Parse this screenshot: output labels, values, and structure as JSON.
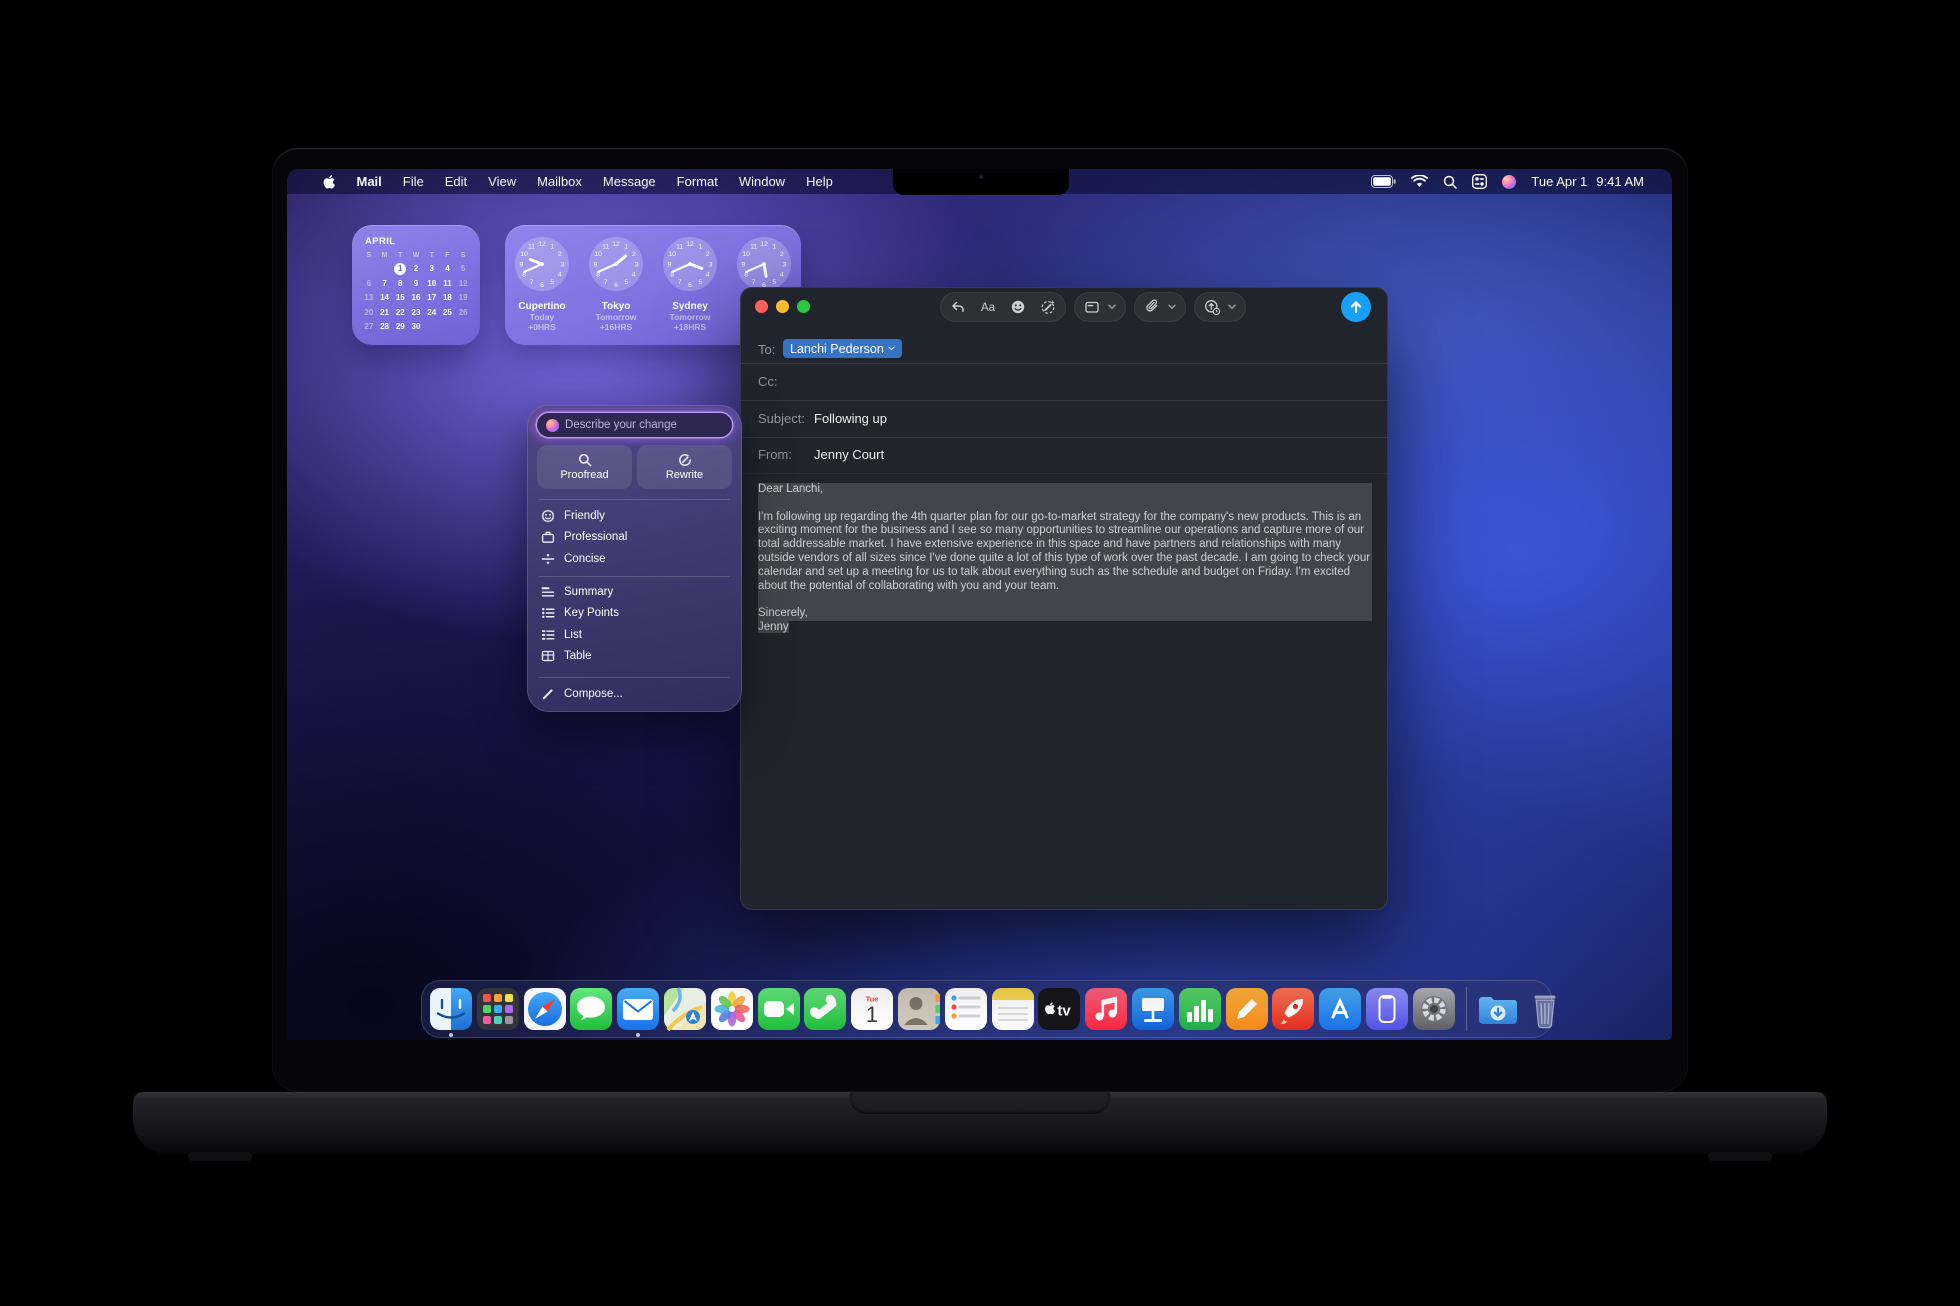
{
  "menu_bar": {
    "active_app": "Mail",
    "menus": [
      "Mail",
      "File",
      "Edit",
      "View",
      "Mailbox",
      "Message",
      "Format",
      "Window",
      "Help"
    ],
    "status_icons": [
      "battery",
      "wifi",
      "spotlight",
      "control-center",
      "siri"
    ],
    "date": "Tue Apr 1",
    "time": "9:41 AM"
  },
  "widgets": {
    "calendar": {
      "month": "APRIL",
      "day_headers": [
        "S",
        "M",
        "T",
        "W",
        "T",
        "F",
        "S"
      ],
      "weeks": [
        [
          "",
          "",
          "1",
          "2",
          "3",
          "4",
          "5"
        ],
        [
          "6",
          "7",
          "8",
          "9",
          "10",
          "11",
          "12"
        ],
        [
          "13",
          "14",
          "15",
          "16",
          "17",
          "18",
          "19"
        ],
        [
          "20",
          "21",
          "22",
          "23",
          "24",
          "25",
          "26"
        ],
        [
          "27",
          "28",
          "29",
          "30",
          "",
          "",
          ""
        ]
      ],
      "selected_day": "1"
    },
    "world_clocks": {
      "cities": [
        {
          "name": "Cupertino",
          "day_label": "Today",
          "offset_label": "+0HRS",
          "hour": 9,
          "minute": 41
        },
        {
          "name": "Tokyo",
          "day_label": "Tomorrow",
          "offset_label": "+16HRS",
          "hour": 1,
          "minute": 41
        },
        {
          "name": "Sydney",
          "day_label": "Tomorrow",
          "offset_label": "+18HRS",
          "hour": 3,
          "minute": 41
        },
        {
          "name": "",
          "day_label": "",
          "offset_label": "",
          "hour": 5,
          "minute": 41
        }
      ]
    }
  },
  "writing_tools": {
    "input_placeholder": "Describe your change",
    "primary_buttons": [
      {
        "label": "Proofread",
        "icon": "magnifier"
      },
      {
        "label": "Rewrite",
        "icon": "rewrite"
      }
    ],
    "tone_options": [
      {
        "label": "Friendly",
        "icon": "smiley"
      },
      {
        "label": "Professional",
        "icon": "briefcase"
      },
      {
        "label": "Concise",
        "icon": "concise"
      }
    ],
    "format_options": [
      {
        "label": "Summary",
        "icon": "summary"
      },
      {
        "label": "Key Points",
        "icon": "keypoints"
      },
      {
        "label": "List",
        "icon": "list"
      },
      {
        "label": "Table",
        "icon": "table"
      }
    ],
    "compose_option": {
      "label": "Compose...",
      "icon": "pencil"
    }
  },
  "mail_window": {
    "toolbar_groups": [
      {
        "icons": [
          "undo",
          "format",
          "emoji",
          "writing-tools"
        ],
        "chevron": false
      },
      {
        "icons": [
          "header-fields"
        ],
        "chevron": true
      },
      {
        "icons": [
          "attach"
        ],
        "chevron": true
      },
      {
        "icons": [
          "insert"
        ],
        "chevron": true
      }
    ],
    "fields": {
      "to_label": "To:",
      "to_value": "Lanchi Pederson",
      "cc_label": "Cc:",
      "cc_value": "",
      "subject_label": "Subject:",
      "subject_value": "Following up",
      "from_label": "From:",
      "from_value": "Jenny Court"
    },
    "body": {
      "greeting": "Dear Lanchi,",
      "paragraph": "I'm following up regarding the 4th quarter plan for our go-to-market strategy for the company's new products. This is an exciting moment for the business and I see so many opportunities to streamline our operations and capture more of our total addressable market. I have extensive experience in this space and have partners and relationships with many outside vendors of all sizes since I've done quite a lot of this type of work over the past decade. I am going to check your calendar and set up a meeting for us to talk about everything such as the schedule and budget on Friday. I'm excited about the potential of collaborating with you and your team.",
      "closing": "Sincerely,",
      "signature": "Jenny"
    }
  },
  "dock": {
    "items": [
      {
        "name": "finder",
        "running": true
      },
      {
        "name": "launchpad"
      },
      {
        "name": "safari"
      },
      {
        "name": "messages"
      },
      {
        "name": "mail",
        "running": true
      },
      {
        "name": "maps"
      },
      {
        "name": "photos"
      },
      {
        "name": "facetime"
      },
      {
        "name": "phone"
      },
      {
        "name": "calendar",
        "badge_day": "Tue",
        "badge_date": "1"
      },
      {
        "name": "contacts"
      },
      {
        "name": "reminders"
      },
      {
        "name": "notes"
      },
      {
        "name": "tv"
      },
      {
        "name": "music"
      },
      {
        "name": "keynote"
      },
      {
        "name": "numbers"
      },
      {
        "name": "pages"
      },
      {
        "name": "rocket"
      },
      {
        "name": "app-store"
      },
      {
        "name": "iphone-mirroring"
      },
      {
        "name": "settings"
      },
      {
        "name": "separator"
      },
      {
        "name": "downloads"
      },
      {
        "name": "trash"
      }
    ]
  },
  "colors": {
    "accent_blue": "#18a0f6",
    "token_blue": "#3673c5",
    "selection_gray": "#41464e",
    "widget_purple": "#7a6ce0"
  }
}
